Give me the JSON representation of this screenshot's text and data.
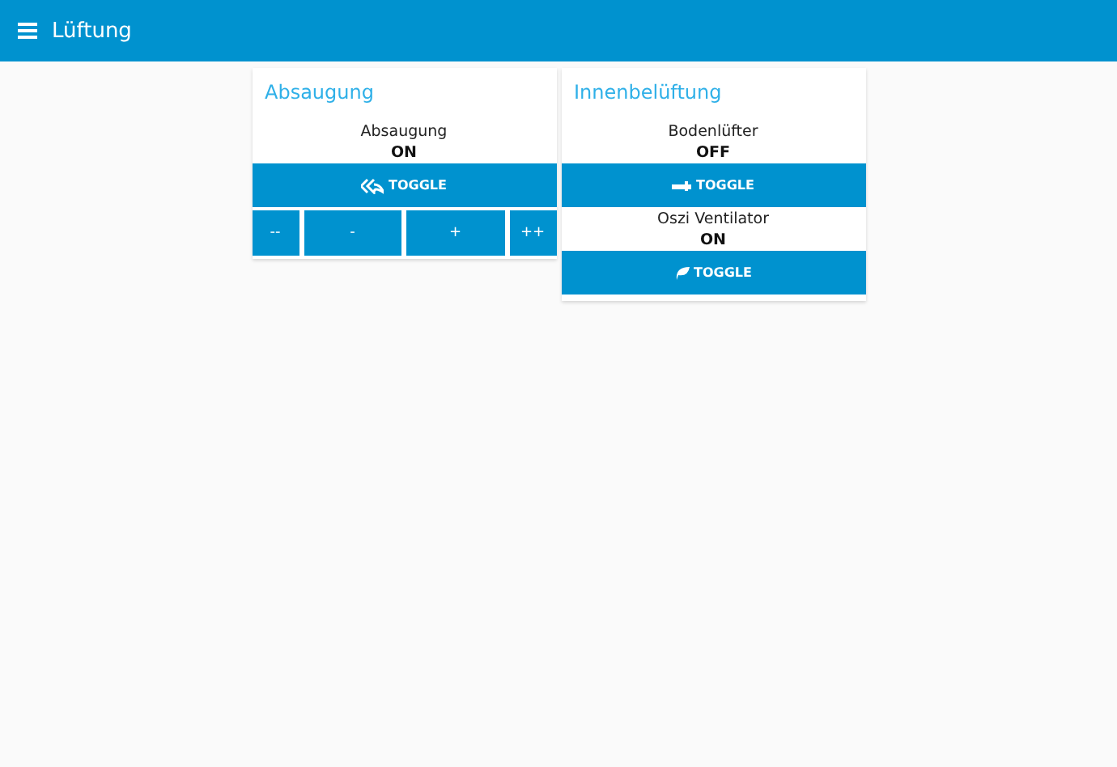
{
  "app_bar": {
    "title": "Lüftung"
  },
  "cards": [
    {
      "title": "Absaugung",
      "devices": [
        {
          "name": "Absaugung",
          "state": "ON",
          "button": {
            "label": "TOGGLE",
            "kind": "reply"
          }
        }
      ],
      "step_buttons": [
        "--",
        "-",
        "+",
        "++"
      ]
    },
    {
      "title": "Innenbelüftung",
      "devices": [
        {
          "name": "Bodenlüfter",
          "state": "OFF",
          "button": {
            "label": "TOGGLE",
            "kind": "pipe"
          }
        },
        {
          "name": "Oszi Ventilator",
          "state": "ON",
          "button": {
            "label": "TOGGLE",
            "kind": "leaf"
          }
        }
      ]
    }
  ]
}
